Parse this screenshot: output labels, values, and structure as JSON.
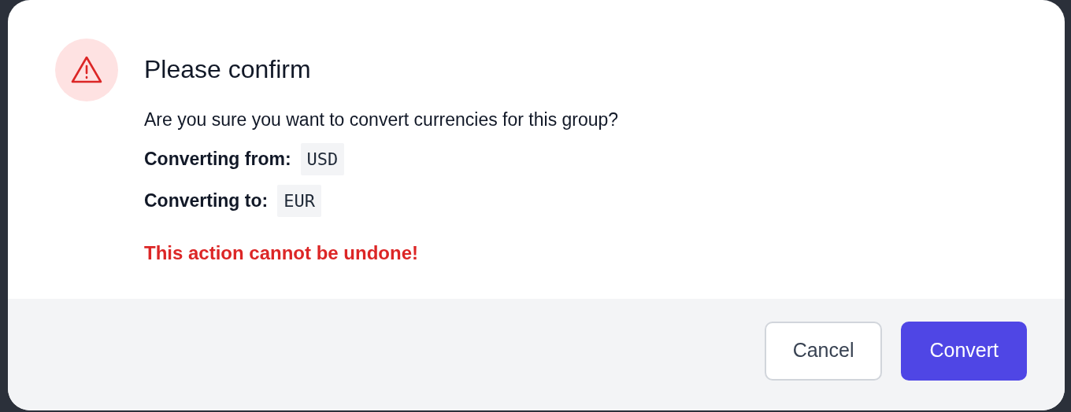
{
  "dialog": {
    "title": "Please confirm",
    "message": "Are you sure you want to convert currencies for this group?",
    "fields": [
      {
        "label": "Converting from:",
        "value": "USD"
      },
      {
        "label": "Converting to:",
        "value": "EUR"
      }
    ],
    "warning": "This action cannot be undone!",
    "buttons": [
      {
        "label": "Cancel",
        "kind": "secondary"
      },
      {
        "label": "Convert",
        "kind": "primary"
      }
    ]
  }
}
